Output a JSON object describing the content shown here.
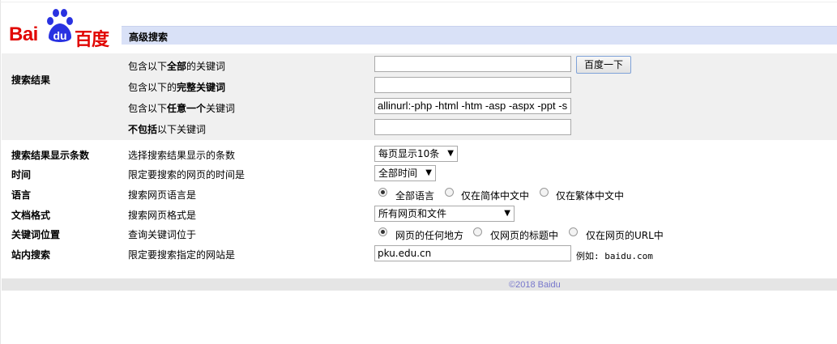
{
  "logo": {
    "text_bai": "Bai",
    "text_du": "du",
    "text_cn": "百度"
  },
  "header": {
    "title": "高级搜索"
  },
  "section_results": {
    "label": "搜索结果",
    "rows": [
      {
        "pre": "包含以下",
        "bold": "全部",
        "post": "的关键词",
        "value": ""
      },
      {
        "pre": "包含以下的",
        "bold": "完整关键词",
        "post": "",
        "value": ""
      },
      {
        "pre": "包含以下",
        "bold": "任意一个",
        "post": "关键词",
        "value": "allinurl:-php -html -htm -asp  -aspx -ppt -s"
      },
      {
        "pre": "",
        "bold": "不包括",
        "post": "以下关键词",
        "value": ""
      }
    ],
    "search_button": "百度一下"
  },
  "options": {
    "count": {
      "label": "搜索结果显示条数",
      "desc": "选择搜索结果显示的条数",
      "selected": "每页显示10条"
    },
    "time": {
      "label": "时间",
      "desc": "限定要搜索的网页的时间是",
      "selected": "全部时间"
    },
    "language": {
      "label": "语言",
      "desc": "搜索网页语言是",
      "choices": [
        "全部语言",
        "仅在简体中文中",
        "仅在繁体中文中"
      ],
      "selected_index": 0
    },
    "format": {
      "label": "文档格式",
      "desc": "搜索网页格式是",
      "selected": "所有网页和文件"
    },
    "position": {
      "label": "关键词位置",
      "desc": "查询关键词位于",
      "choices": [
        "网页的任何地方",
        "仅网页的标题中",
        "仅在网页的URL中"
      ],
      "selected_index": 0
    },
    "site": {
      "label": "站内搜索",
      "desc": "限定要搜索指定的网站是",
      "value": "pku.edu.cn",
      "example": "例如:  baidu.com"
    }
  },
  "footer": {
    "copyright": "©2018 Baidu"
  },
  "colors": {
    "brand_red": "#e10602",
    "brand_blue": "#2932e1",
    "header_bar": "#d9e1f7",
    "footer_text": "#7777cc"
  }
}
